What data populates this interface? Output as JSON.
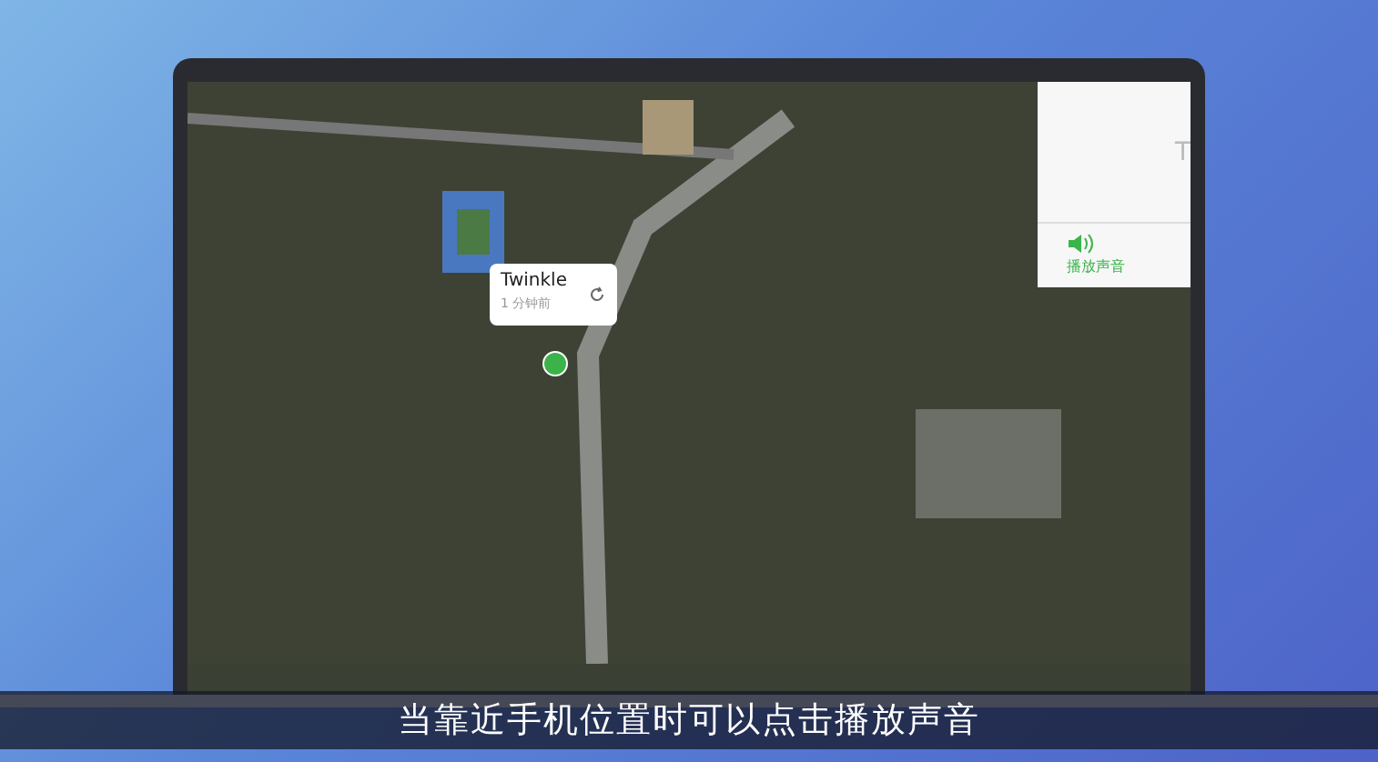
{
  "map_popup": {
    "title": "Twinkle",
    "subtitle": "1 分钟前"
  },
  "device_panel": {
    "title": "T",
    "action": "播放声音"
  },
  "subtitle": "当靠近手机位置时可以点击播放声音"
}
